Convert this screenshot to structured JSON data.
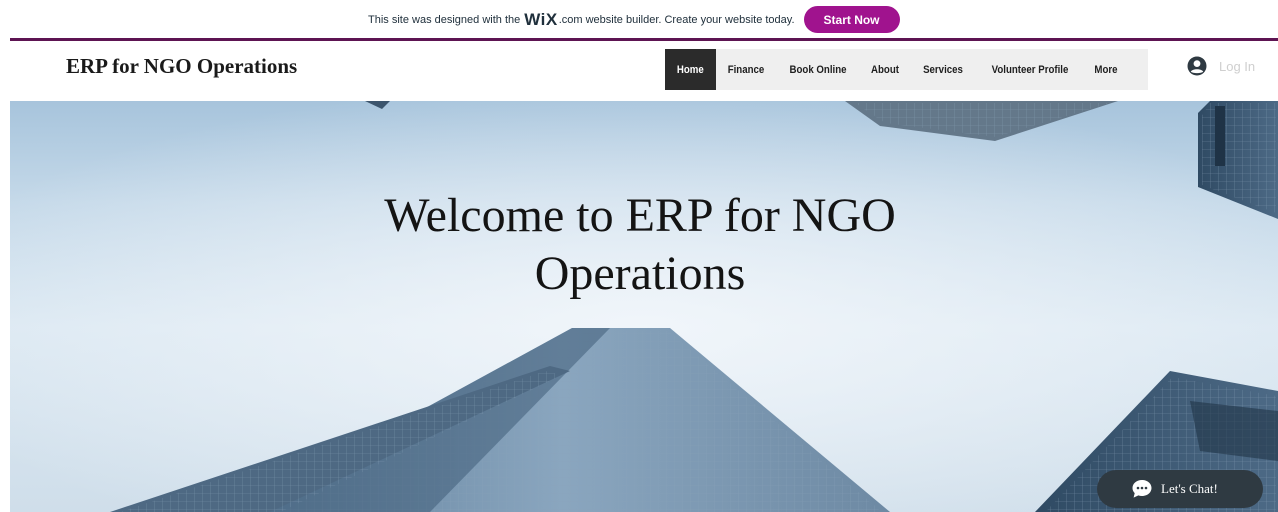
{
  "wix_banner": {
    "text_before": "This site was designed with the",
    "logo": "WiX",
    "text_after": ".com website builder. Create your website today.",
    "button_label": "Start Now",
    "button_color": "#a0138e"
  },
  "header": {
    "site_title": "ERP for NGO Operations",
    "nav": [
      {
        "label": "Home",
        "active": true
      },
      {
        "label": "Finance"
      },
      {
        "label": "Book Online"
      },
      {
        "label": "About"
      },
      {
        "label": "Services"
      },
      {
        "label": "Volunteer Profile"
      },
      {
        "label": "More"
      }
    ],
    "login_label": "Log In",
    "login_icon": "user-icon"
  },
  "hero": {
    "heading_line1": "Welcome to ERP for NGO",
    "heading_line2": "Operations",
    "background": "skyscrapers-upward-view"
  },
  "chat": {
    "label": "Let's Chat!",
    "icon": "chat-bubble-icon"
  },
  "colors": {
    "accent": "#a0138e",
    "banner_line": "#5d1452",
    "nav_active": "#2b2b2b",
    "chat_bg": "#2f3a42"
  }
}
